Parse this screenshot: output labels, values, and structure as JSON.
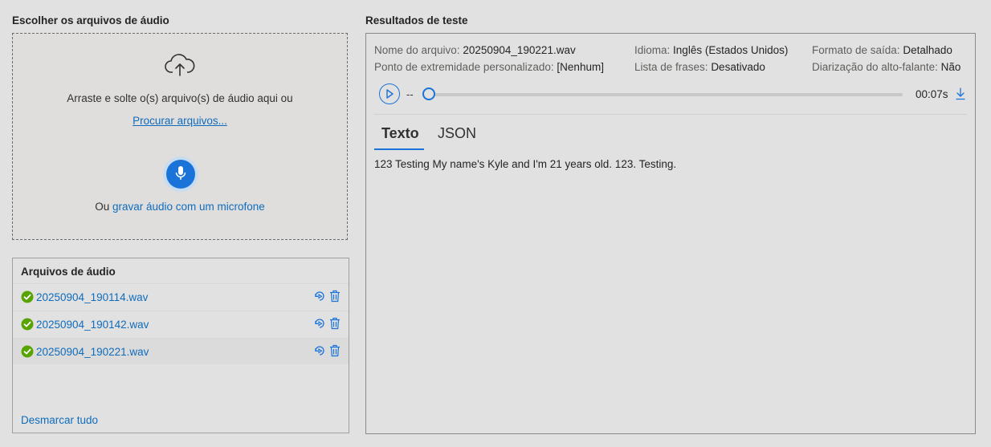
{
  "left": {
    "choose_title": "Escolher os arquivos de áudio",
    "drop_text": "Arraste e solte o(s) arquivo(s) de áudio aqui ou",
    "browse_link": "Procurar arquivos...",
    "record_prefix": "Ou ",
    "record_link": "gravar áudio com um microfone"
  },
  "files": {
    "title": "Arquivos de áudio",
    "items": [
      {
        "name": "20250904_190114.wav"
      },
      {
        "name": "20250904_190142.wav"
      },
      {
        "name": "20250904_190221.wav"
      }
    ],
    "deselect_all": "Desmarcar tudo"
  },
  "results": {
    "title": "Resultados de teste",
    "file_name_label": "Nome do arquivo:",
    "file_name_value": "20250904_190221.wav",
    "language_label": "Idioma:",
    "language_value": "Inglês (Estados Unidos)",
    "output_format_label": "Formato de saída:",
    "output_format_value": "Detalhado",
    "endpoint_label": "Ponto de extremidade personalizado:",
    "endpoint_value": "[Nenhum]",
    "phrase_list_label": "Lista de frases:",
    "phrase_list_value": "Desativado",
    "diarization_label": "Diarização do alto-falante:",
    "diarization_value": "Não",
    "player": {
      "current": "--",
      "duration": "00:07s",
      "progress": 0
    },
    "tabs": [
      {
        "label": "Texto",
        "active": true
      },
      {
        "label": "JSON",
        "active": false
      }
    ],
    "transcript": "123 Testing My name's Kyle and I'm 21 years old. 123. Testing."
  },
  "colors": {
    "accent": "#1a73d9",
    "link": "#0f6cbd",
    "success": "#57a300"
  }
}
